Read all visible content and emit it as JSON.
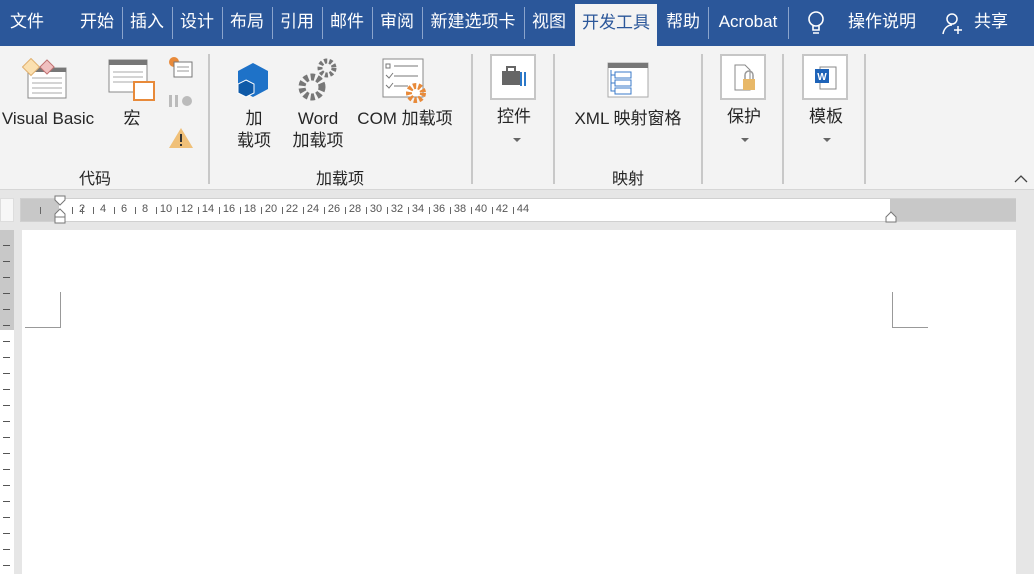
{
  "tabs": [
    "文件",
    "开始",
    "插入",
    "设计",
    "布局",
    "引用",
    "邮件",
    "审阅",
    "新建选项卡",
    "视图",
    "开发工具",
    "帮助",
    "Acrobat"
  ],
  "active_tab": "开发工具",
  "tell_me": "操作说明",
  "share": "共享",
  "groups": {
    "code": {
      "label": "代码",
      "visual_basic": "Visual Basic",
      "macro": "宏"
    },
    "addins": {
      "label": "加载项",
      "addins_btn": "加\n载项",
      "addins_l1": "加",
      "addins_l2": "载项",
      "word_l1": "Word",
      "word_l2": "加载项",
      "com": "COM 加载项"
    },
    "controls": {
      "label": "控件"
    },
    "mapping": {
      "label": "映射",
      "xml": "XML 映射窗格"
    },
    "protect": {
      "label": "保护"
    },
    "templates": {
      "label": "模板"
    }
  },
  "ruler": {
    "numbers": [
      "2",
      "4",
      "6",
      "8",
      "10",
      "12",
      "14",
      "16",
      "18",
      "20",
      "22",
      "24",
      "26",
      "28",
      "30",
      "32",
      "34",
      "36",
      "38",
      "40",
      "42",
      "44"
    ]
  },
  "colors": {
    "brand": "#2b579a",
    "ribbon": "#f3f3f3"
  }
}
